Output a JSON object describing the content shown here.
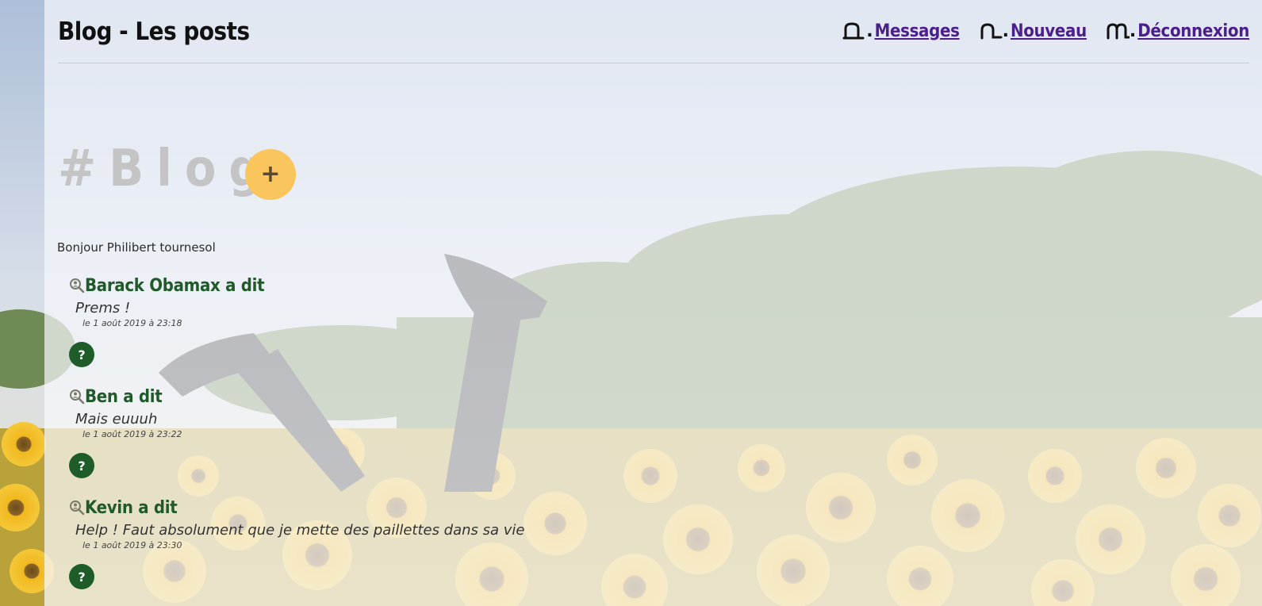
{
  "header": {
    "title": "Blog - Les posts",
    "nav": [
      {
        "icon": "messages-icon",
        "label": "Messages"
      },
      {
        "icon": "new-post-icon",
        "label": "Nouveau"
      },
      {
        "icon": "logout-icon",
        "label": "Déconnexion"
      }
    ],
    "nav_separator": "."
  },
  "hero": {
    "heading": "#Blog",
    "add_button_label": "+"
  },
  "greeting": "Bonjour Philibert tournesol",
  "posts": [
    {
      "author": "Barack Obamax a dit",
      "message": "Prems !",
      "date": "le 1 août 2019 à 23:18",
      "help_label": "?"
    },
    {
      "author": "Ben a dit",
      "message": "Mais euuuh",
      "date": "le 1 août 2019 à 23:22",
      "help_label": "?"
    },
    {
      "author": "Kevin a dit",
      "message": "Help ! Faut absolument que je mette des paillettes dans sa vie",
      "date": "le 1 août 2019 à 23:30",
      "help_label": "?"
    }
  ],
  "colors": {
    "accent_add": "#fbc55e",
    "author_green": "#1f5a29",
    "help_green": "#1e5d2a",
    "nav_link": "#4b1e8c",
    "heading_gray": "#c4c4c4"
  }
}
